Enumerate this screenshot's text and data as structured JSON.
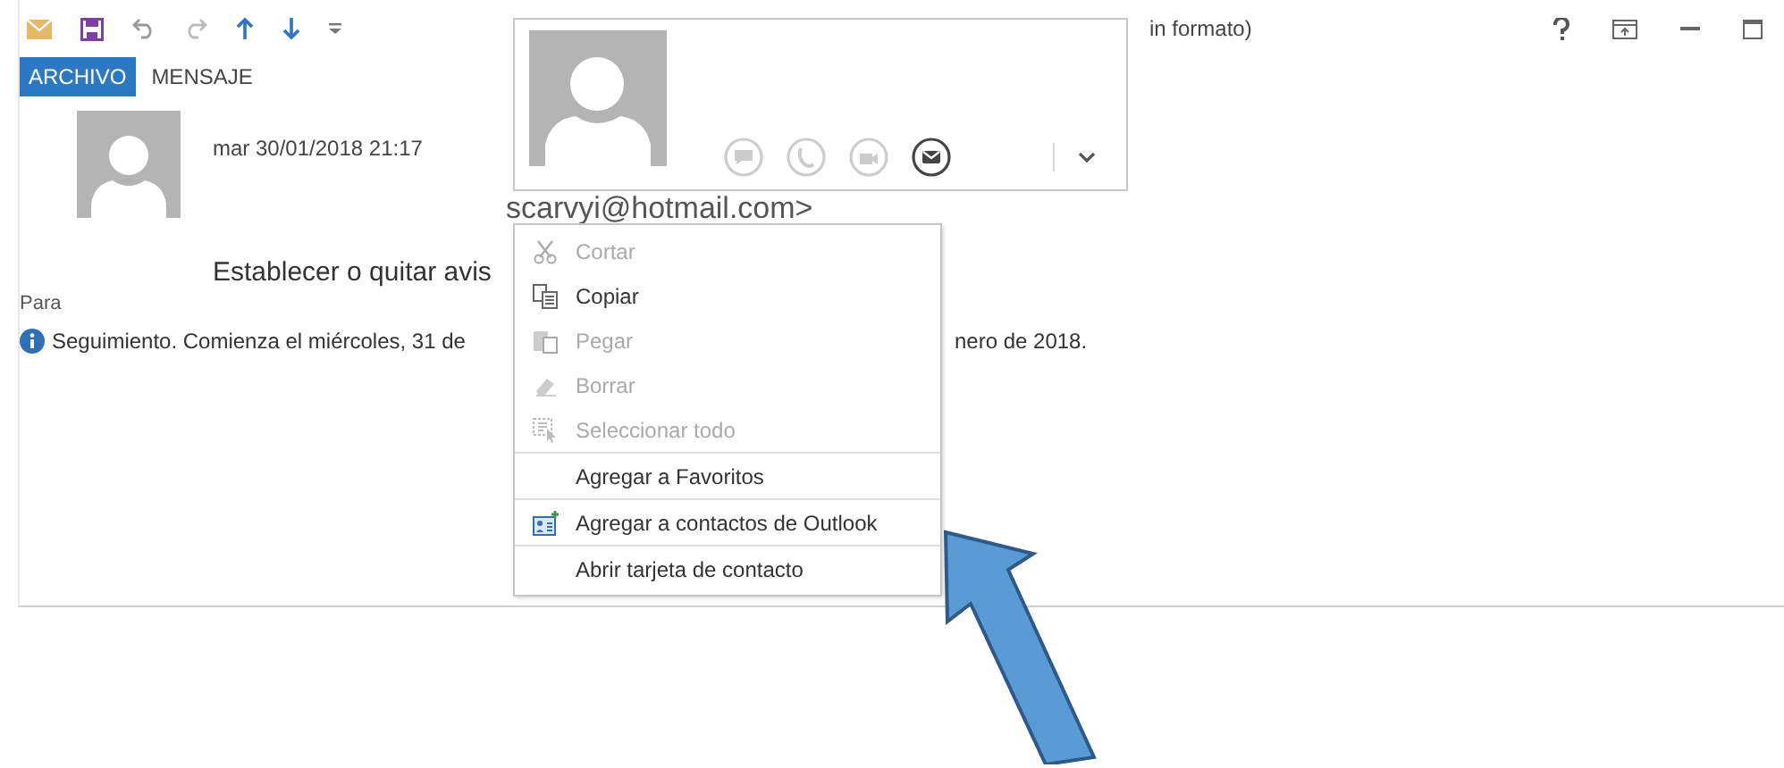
{
  "title_bar": {
    "title": "in formato)"
  },
  "tabs": [
    {
      "label": "ARCHIVO",
      "selected": true
    },
    {
      "label": "MENSAJE",
      "selected": false
    }
  ],
  "message": {
    "date": "mar 30/01/2018 21:17",
    "sender": "scarvyi@hotmail.com>",
    "subject": "Establecer o quitar avis",
    "to_label": "Para",
    "info": "Seguimiento.  Comienza el miércoles, 31 de",
    "info_end": "nero de 2018."
  },
  "contact_card": {
    "actions": [
      {
        "kind": "chat",
        "enabled": false
      },
      {
        "kind": "call",
        "enabled": false
      },
      {
        "kind": "video",
        "enabled": false
      },
      {
        "kind": "mail",
        "enabled": true
      }
    ]
  },
  "context_menu": {
    "items": [
      {
        "label": "Cortar",
        "kind": "cut",
        "disabled": true,
        "separator_after": false
      },
      {
        "label": "Copiar",
        "kind": "copy",
        "disabled": false,
        "separator_after": false
      },
      {
        "label": "Pegar",
        "kind": "paste",
        "disabled": true,
        "separator_after": false
      },
      {
        "label": "Borrar",
        "kind": "erase",
        "disabled": true,
        "separator_after": false
      },
      {
        "label": "Seleccionar todo",
        "kind": "select",
        "disabled": true,
        "separator_after": true
      },
      {
        "label": "Agregar a Favoritos",
        "kind": "plain",
        "disabled": false,
        "separator_after": true
      },
      {
        "label": "Agregar a contactos de Outlook",
        "kind": "contact",
        "disabled": false,
        "separator_after": true
      },
      {
        "label": "Abrir tarjeta de contacto",
        "kind": "plain",
        "disabled": false,
        "separator_after": false
      }
    ]
  }
}
